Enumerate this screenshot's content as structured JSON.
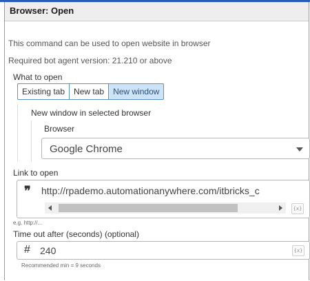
{
  "panel": {
    "title": "Browser: Open",
    "description": "This command can be used to open website in browser",
    "required_version": "Required bot agent version: 21.210 or above"
  },
  "open_mode": {
    "label": "What to open",
    "options": [
      "Existing tab",
      "New tab",
      "New window"
    ],
    "selected": "New window"
  },
  "new_window": {
    "label": "New window in selected browser",
    "browser_label": "Browser",
    "browser_value": "Google Chrome"
  },
  "link": {
    "label": "Link to open",
    "value": "http://rpademo.automationanywhere.com/itbricks_c",
    "hint": "e.g. http://..."
  },
  "timeout": {
    "label": "Time out after (seconds) (optional)",
    "value": "240",
    "hint": "Recommended min = 9 seconds"
  },
  "icons": {
    "string": "quote-icon",
    "number": "hash-icon",
    "variable": "variable-icon",
    "variable_text": "{x}"
  },
  "colors": {
    "accent": "#5a8fc8",
    "active_segment": "#cde3f7",
    "header_bg": "#eeeeee"
  }
}
